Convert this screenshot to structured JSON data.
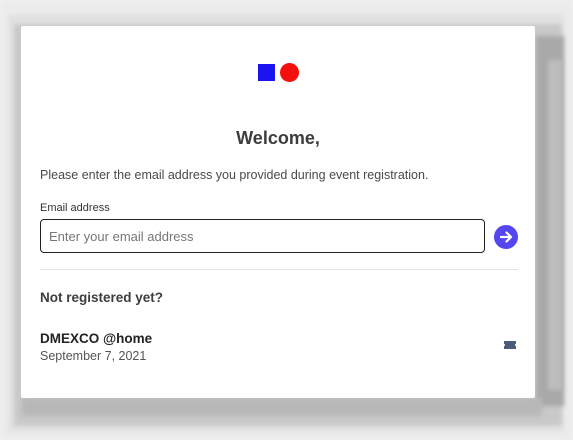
{
  "logo": {
    "icon": "brand-logo-square-and-circle",
    "square_color": "#1b14f0",
    "circle_color": "#f40f0f"
  },
  "welcome": {
    "title": "Welcome,",
    "instructions": "Please enter the email address you provided during event registration."
  },
  "email": {
    "label": "Email address",
    "placeholder": "Enter your email address",
    "value": ""
  },
  "submit": {
    "icon": "arrow-right-circle-icon",
    "color": "#5546f0"
  },
  "registration": {
    "heading": "Not registered yet?",
    "events": [
      {
        "name": "DMEXCO @home",
        "date": "September 7, 2021",
        "icon": "ticket-icon"
      }
    ]
  }
}
